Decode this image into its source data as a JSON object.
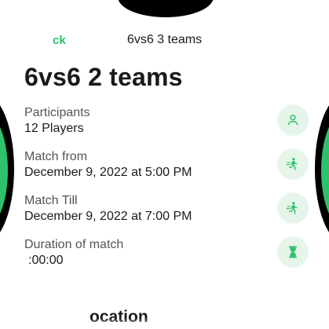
{
  "header": {
    "back_label": "ck",
    "title": "6vs6 3 teams"
  },
  "page_title": "6vs6 2 teams",
  "details": [
    {
      "label": "Participants",
      "value": "12 Players",
      "icon": "person-icon"
    },
    {
      "label": "Match from",
      "value": "December 9, 2022 at 5:00 PM",
      "icon": "running-player-icon"
    },
    {
      "label": "Match Till",
      "value": "December 9, 2022 at 7:00 PM",
      "icon": "running-player-icon"
    },
    {
      "label": "Duration of match",
      "value": ":00:00",
      "icon": "hourglass-icon"
    }
  ],
  "section_heading": "ocation",
  "colors": {
    "accent": "#2ec26b",
    "icon_bg": "#e6f5ea",
    "text": "#1a1a1a",
    "label": "#555555"
  }
}
